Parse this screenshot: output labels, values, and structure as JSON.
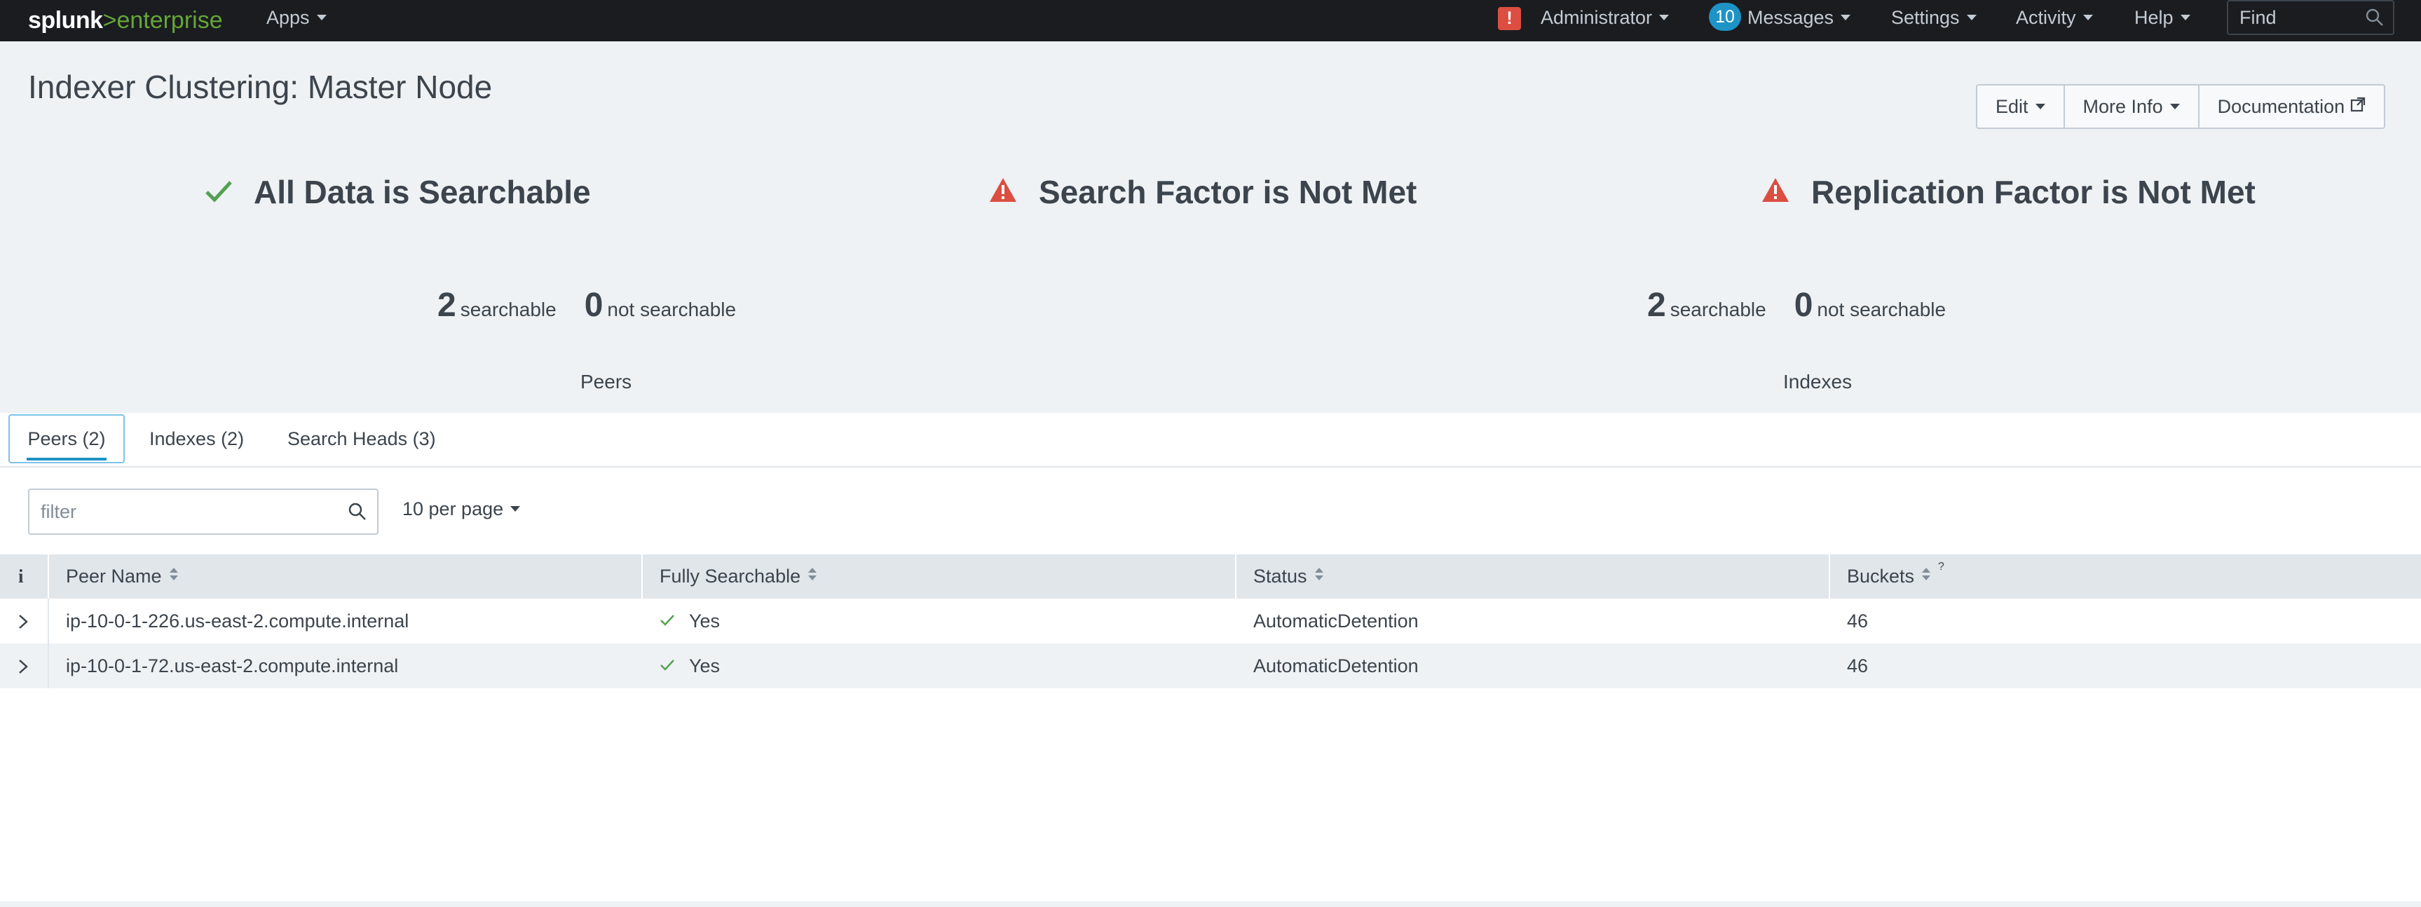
{
  "app": {
    "logo_primary": "splunk",
    "logo_separator": ">",
    "logo_secondary": "enterprise",
    "brand_color": "#65a637"
  },
  "topnav": {
    "apps_label": "Apps",
    "alert_badge": "!",
    "admin_label": "Administrator",
    "messages_count": "10",
    "messages_label": "Messages",
    "settings_label": "Settings",
    "activity_label": "Activity",
    "help_label": "Help",
    "find_placeholder": "Find"
  },
  "page": {
    "title": "Indexer Clustering: Master Node",
    "actions": {
      "edit_label": "Edit",
      "more_info_label": "More Info",
      "documentation_label": "Documentation"
    }
  },
  "summary": {
    "searchable_status": "All Data is Searchable",
    "search_factor_status": "Search Factor is Not Met",
    "replication_factor_status": "Replication Factor is Not Met",
    "peers": {
      "searchable_count": "2",
      "searchable_label": "searchable",
      "not_searchable_count": "0",
      "not_searchable_label": "not searchable",
      "caption": "Peers"
    },
    "indexes": {
      "searchable_count": "2",
      "searchable_label": "searchable",
      "not_searchable_count": "0",
      "not_searchable_label": "not searchable",
      "caption": "Indexes"
    },
    "status_colors": {
      "ok": "#53a051",
      "warning": "#dc4e41"
    }
  },
  "tabs": {
    "peers": "Peers (2)",
    "indexes": "Indexes (2)",
    "search_heads": "Search Heads (3)"
  },
  "controls": {
    "filter_placeholder": "filter",
    "per_page_label": "10 per page"
  },
  "table": {
    "info_col": "i",
    "columns": {
      "peer_name": "Peer Name",
      "fully_searchable": "Fully Searchable",
      "status": "Status",
      "buckets": "Buckets",
      "buckets_help": "?"
    },
    "rows": [
      {
        "peer_name": "ip-10-0-1-226.us-east-2.compute.internal",
        "fully_searchable": "Yes",
        "status": "AutomaticDetention",
        "buckets": "46"
      },
      {
        "peer_name": "ip-10-0-1-72.us-east-2.compute.internal",
        "fully_searchable": "Yes",
        "status": "AutomaticDetention",
        "buckets": "46"
      }
    ]
  }
}
